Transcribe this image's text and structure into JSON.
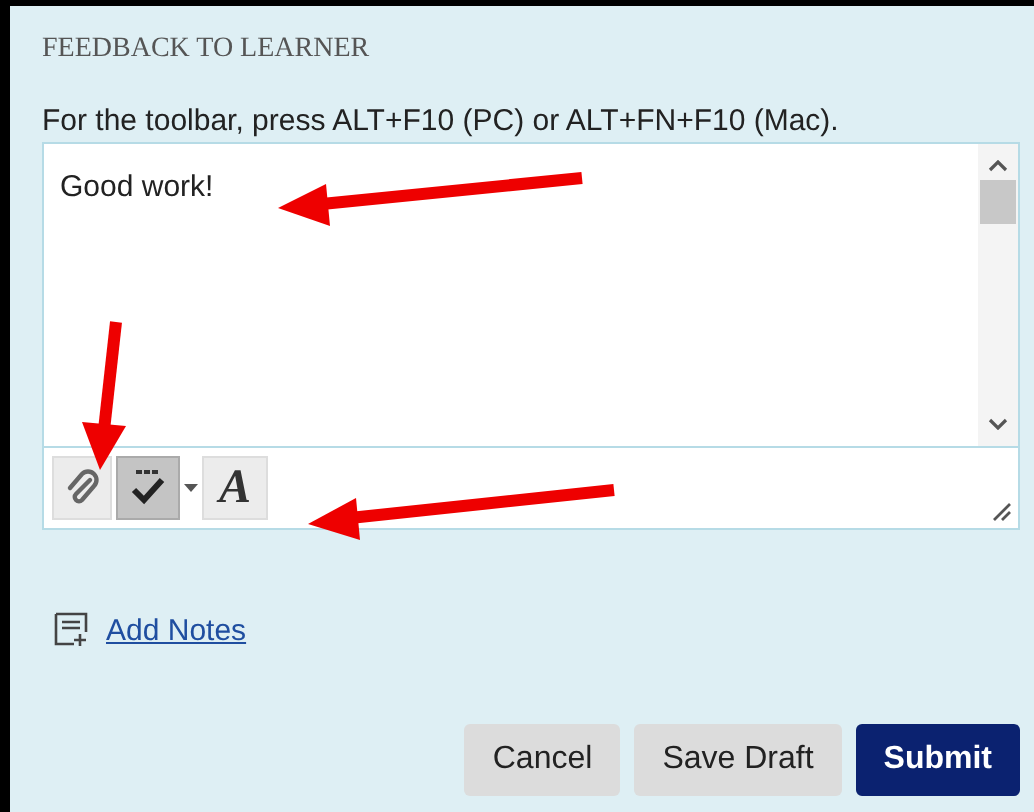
{
  "heading": "FEEDBACK TO LEARNER",
  "instruction": "For the toolbar, press ALT+F10 (PC) or ALT+FN+F10 (Mac).",
  "editor": {
    "value": "Good work!"
  },
  "toolbar": [
    {
      "kind": "attach",
      "selected": false
    },
    {
      "kind": "spellcheck",
      "selected": true
    },
    {
      "kind": "format",
      "selected": false
    }
  ],
  "format_glyph": "A",
  "add_notes": "Add Notes",
  "buttons": [
    {
      "label": "Cancel",
      "kind": "secondary"
    },
    {
      "label": "Save Draft",
      "kind": "secondary"
    },
    {
      "label": "Submit",
      "kind": "primary"
    }
  ]
}
